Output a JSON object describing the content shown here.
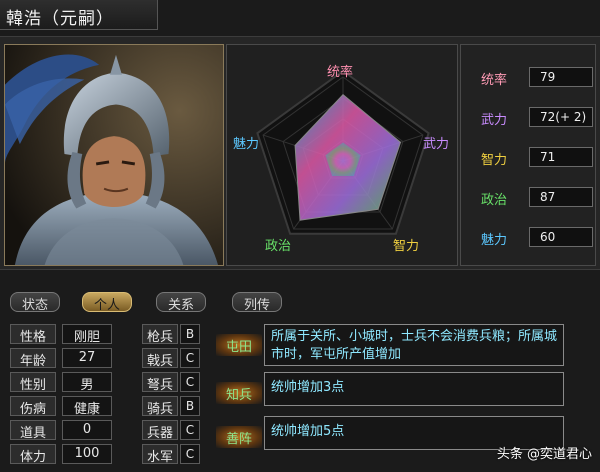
{
  "header": {
    "title": "韓浩（元嗣）"
  },
  "radar": {
    "labels": {
      "lead": "统率",
      "war": "武力",
      "int": "智力",
      "pol": "政治",
      "cha": "魅力"
    },
    "values": {
      "lead": 79,
      "war": 72,
      "int": 71,
      "pol": 87,
      "cha": 60
    },
    "max": 100
  },
  "stats": [
    {
      "label": "统率",
      "value": "79",
      "color": "#ff9bb5"
    },
    {
      "label": "武力",
      "value": "72(+ 2)",
      "color": "#c98cff"
    },
    {
      "label": "智力",
      "value": "71",
      "color": "#f0d040"
    },
    {
      "label": "政治",
      "value": "87",
      "color": "#68e068"
    },
    {
      "label": "魅力",
      "value": "60",
      "color": "#5cc8ff"
    }
  ],
  "tabs": [
    {
      "label": "状态",
      "active": false
    },
    {
      "label": "个人",
      "active": true
    },
    {
      "label": "关系",
      "active": false
    },
    {
      "label": "列传",
      "active": false
    }
  ],
  "personal": [
    {
      "label": "性格",
      "value": "刚胆"
    },
    {
      "label": "年龄",
      "value": "27"
    },
    {
      "label": "性别",
      "value": "男"
    },
    {
      "label": "伤病",
      "value": "健康"
    },
    {
      "label": "道具",
      "value": "0"
    },
    {
      "label": "体力",
      "value": "100"
    }
  ],
  "troops": [
    {
      "label": "枪兵",
      "grade": "B"
    },
    {
      "label": "戟兵",
      "grade": "C"
    },
    {
      "label": "弩兵",
      "grade": "C"
    },
    {
      "label": "骑兵",
      "grade": "B"
    },
    {
      "label": "兵器",
      "grade": "C"
    },
    {
      "label": "水军",
      "grade": "C"
    }
  ],
  "skills": [
    {
      "name": "屯田",
      "desc": "所属于关所、小城时，士兵不会消费兵粮；所属城市时，军屯所产值增加"
    },
    {
      "name": "知兵",
      "desc": "统帅增加3点"
    },
    {
      "name": "善阵",
      "desc": "统帅增加5点"
    }
  ],
  "watermark": "头条 @奕道君心"
}
